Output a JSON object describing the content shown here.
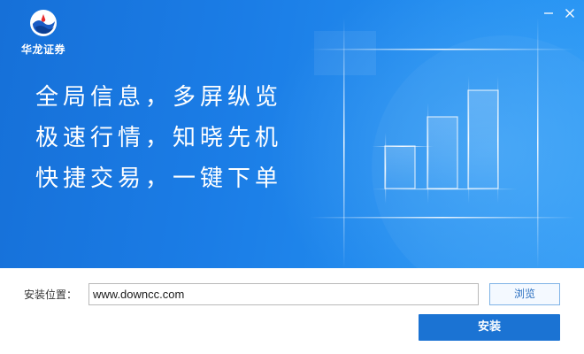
{
  "app": {
    "brand_name": "华龙证券",
    "colors": {
      "banner": "#1b7de6",
      "accent": "#1b73d3",
      "logo_red": "#e8292b"
    }
  },
  "window_controls": {
    "minimize_icon": "minimize-icon",
    "close_icon": "close-icon"
  },
  "slogans": [
    "全局信息，多屏纵览",
    "极速行情，知晓先机",
    "快捷交易，一键下单"
  ],
  "install": {
    "path_label": "安装位置：",
    "path_value": "www.downcc.com",
    "browse_label": "浏览",
    "install_label": "安装"
  }
}
